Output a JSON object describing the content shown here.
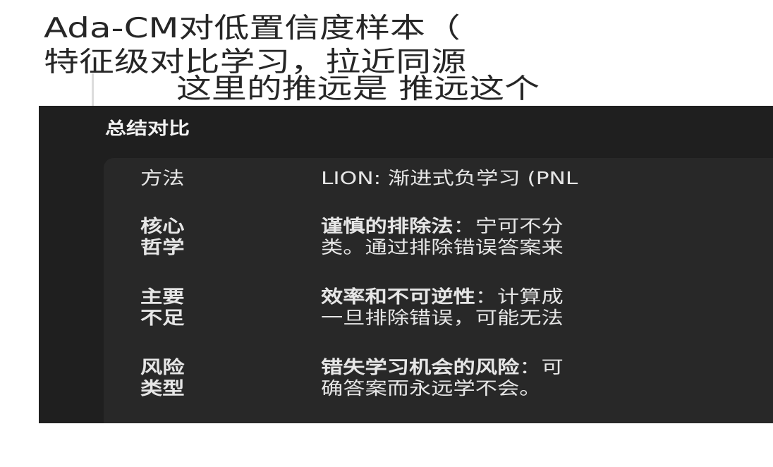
{
  "text": {
    "line1": "Ada-CM对低置信度样本（",
    "line2": "特征级对比学习，拉近同源",
    "quote": "这里的推远是 推远这个"
  },
  "panel": {
    "title": "总结对比",
    "rows": [
      {
        "label": [
          "方法"
        ],
        "label_bold": false,
        "value_bold": "",
        "value_rest": "LION: 渐进式负学习 (PNL",
        "value_line2": ""
      },
      {
        "label": [
          "核心",
          "哲学"
        ],
        "label_bold": true,
        "value_bold": "谨慎的排除法",
        "value_rest": "：宁可不分",
        "value_line2": "类。通过排除错误答案来"
      },
      {
        "label": [
          "主要",
          "不足"
        ],
        "label_bold": true,
        "value_bold": "效率和不可逆性",
        "value_rest": "：计算成",
        "value_line2": "一旦排除错误，可能无法"
      },
      {
        "label": [
          "风险",
          "类型"
        ],
        "label_bold": true,
        "value_bold": "错失学习机会的风险",
        "value_rest": "：可",
        "value_line2": "确答案而永远学不会。"
      }
    ]
  }
}
